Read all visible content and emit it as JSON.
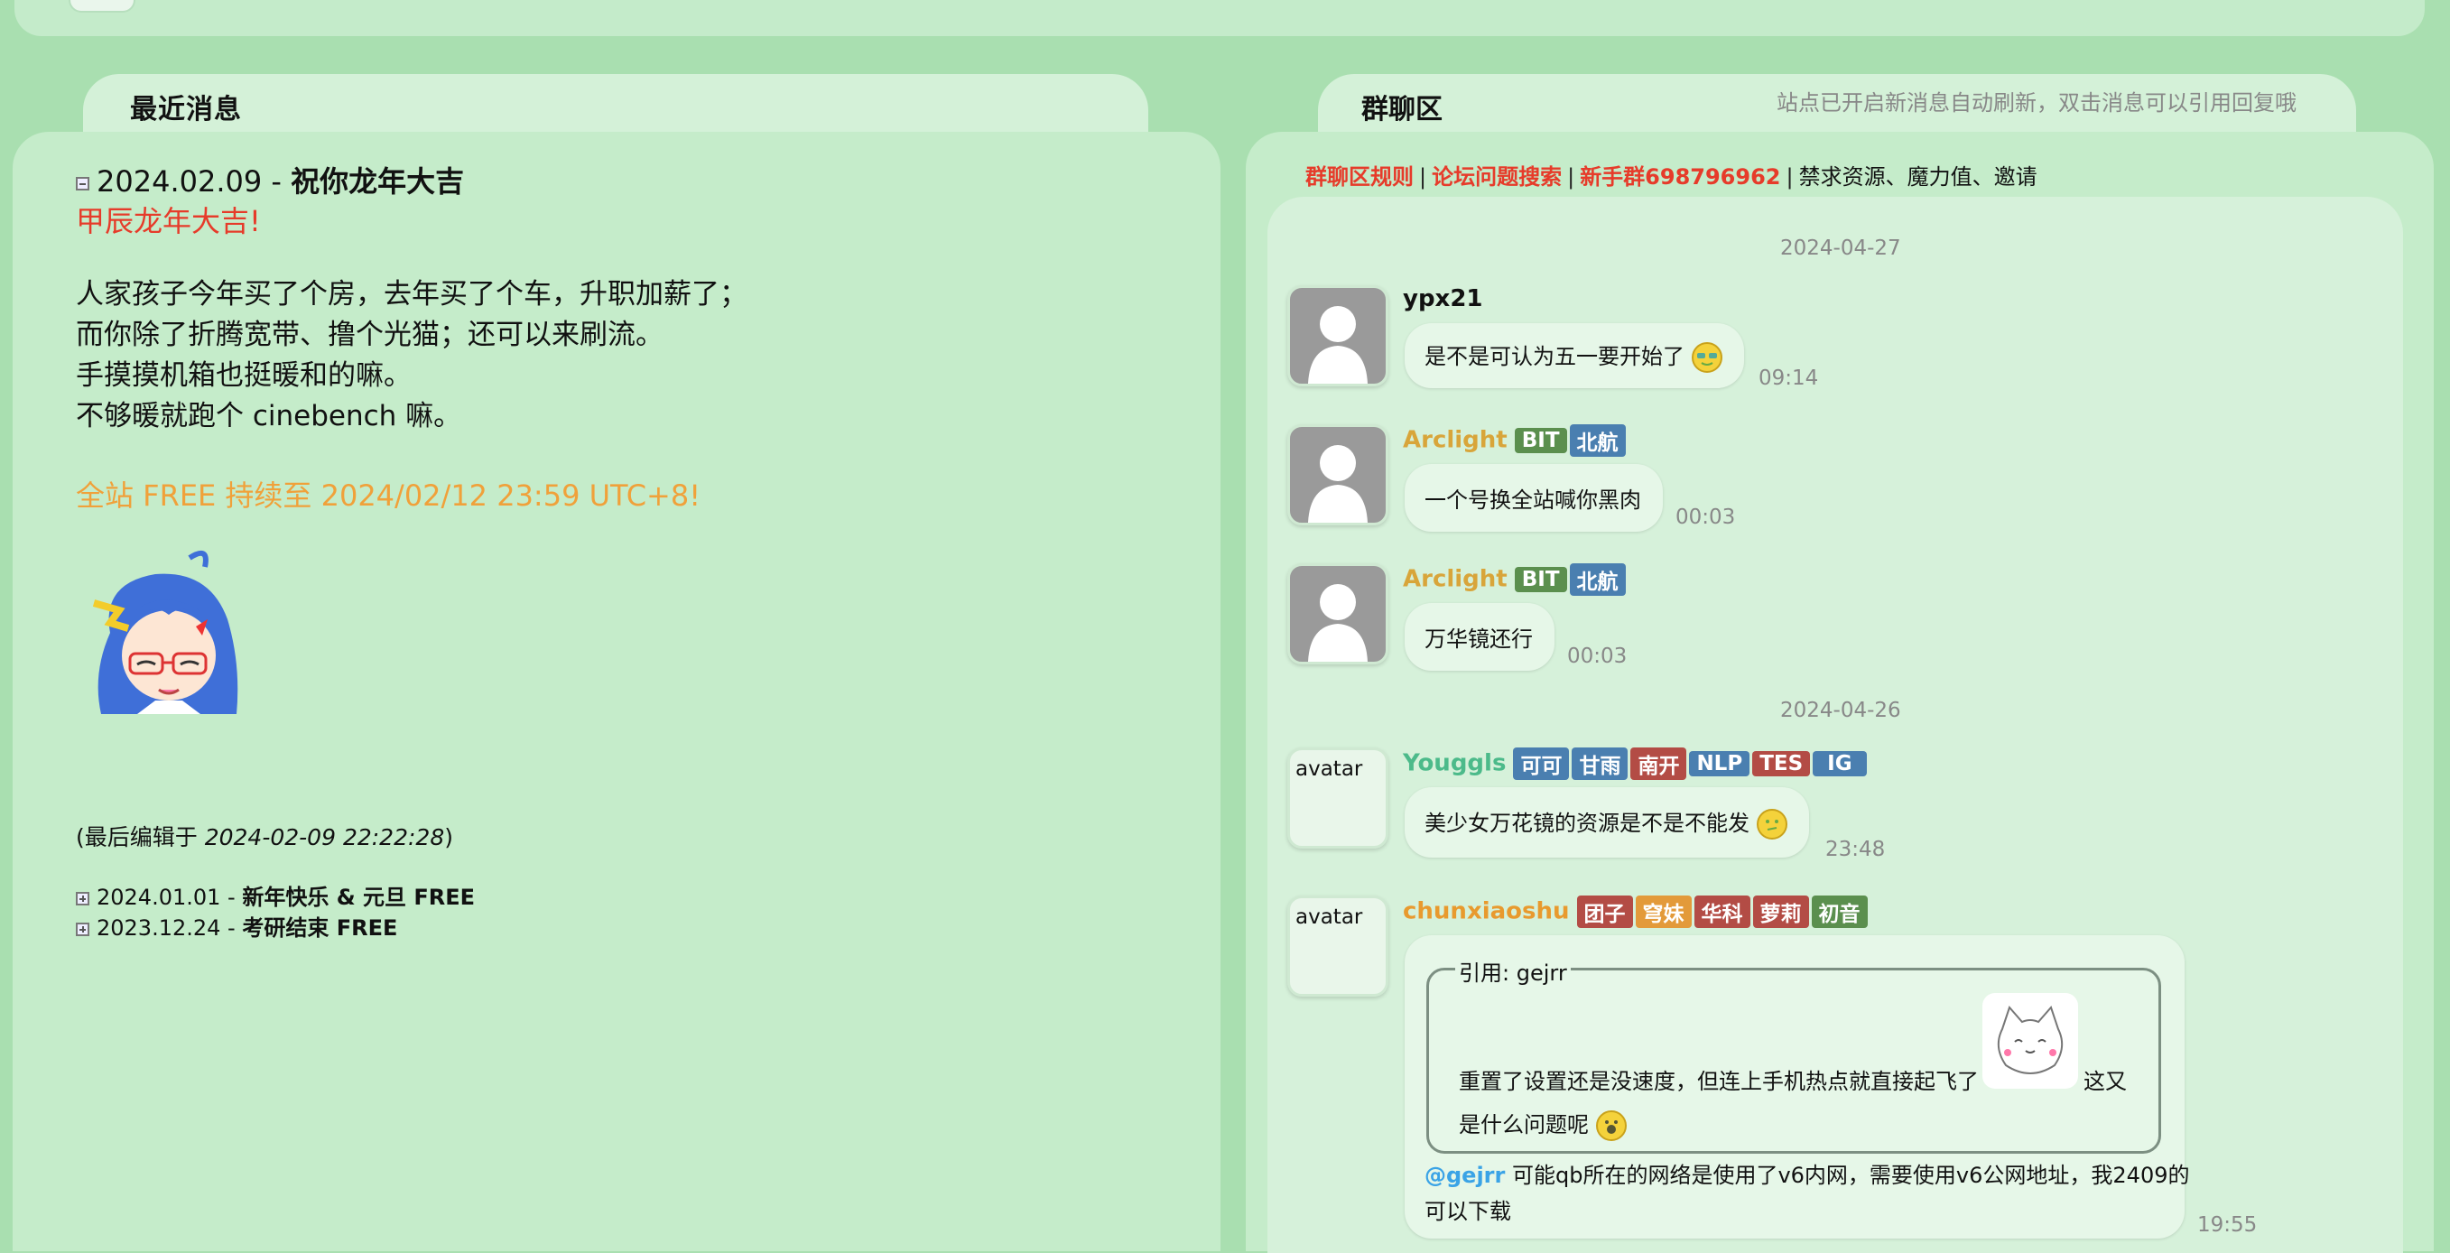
{
  "recent": {
    "title": "最近消息",
    "current": {
      "date": "2024.02.09",
      "dash": " - ",
      "headline": "祝你龙年大吉",
      "red_line": "甲辰龙年大吉!",
      "body": [
        "人家孩子今年买了个房，去年买了个车，升职加薪了；",
        "而你除了折腾宽带、撸个光猫；还可以来刷流。",
        "手摸摸机箱也挺暖和的嘛。",
        "不够暖就跑个 cinebench 嘛。"
      ],
      "orange_line": "全站 FREE 持续至 2024/02/12 23:59 UTC+8!",
      "edited_prefix": "(最后编辑于 ",
      "edited_time": "2024-02-09 22:22:28",
      "edited_suffix": ")"
    },
    "older": [
      {
        "date": "2024.01.01",
        "title": "新年快乐 & 元旦 FREE"
      },
      {
        "date": "2023.12.24",
        "title": "考研结束 FREE"
      }
    ]
  },
  "chat": {
    "title": "群聊区",
    "note": "站点已开启新消息自动刷新，双击消息可以引用回复哦",
    "links": [
      "群聊区规则",
      "论坛问题搜索",
      "新手群698796962"
    ],
    "links_tail": "禁求资源、魔力值、邀请",
    "sep": "|",
    "dates": [
      "2024-04-27",
      "2024-04-26"
    ],
    "messages": [
      {
        "user": "ypx21",
        "text": "是不是可认为五一要开始了",
        "time": "09:14",
        "avatar": "default"
      },
      {
        "user": "Arclight",
        "badges": [
          "BIT",
          "北航"
        ],
        "text": "一个号换全站喊你黑肉",
        "time": "00:03",
        "avatar": "default"
      },
      {
        "user": "Arclight",
        "badges": [
          "BIT",
          "北航"
        ],
        "text": "万华镜还行",
        "time": "00:03",
        "avatar": "default"
      },
      {
        "user": "Youggls",
        "badges": [
          "可可",
          "甘雨",
          "南开",
          "NLP",
          "TES",
          "IG"
        ],
        "text": "美少女万花镜的资源是不是不能发",
        "time": "23:48",
        "avatar": "avatar"
      },
      {
        "user": "chunxiaoshu",
        "badges": [
          "团子",
          "穹妹",
          "华科",
          "萝莉",
          "初音"
        ],
        "quote_label": "引用: gejrr",
        "quote_line1": "重置了设置还是没速度，但连上手机热点就直接起飞了",
        "quote_line1b": "这又",
        "quote_line2": "是什么问题呢",
        "mention": "@gejrr",
        "reply_line1": " 可能qb所在的网络是使用了v6内网，需要使用v6公网地址，我2409的",
        "reply_line2": "可以下载",
        "time": "19:55",
        "avatar": "avatar"
      }
    ]
  },
  "colors": {
    "badge_green": "#5b8f4e",
    "badge_blue": "#4a7fb0",
    "badge_red": "#b34c45",
    "badge_orange": "#e39a3a",
    "name_gold": "#d8a53a",
    "name_teal": "#4cba8a",
    "name_orange": "#e89a2e"
  }
}
